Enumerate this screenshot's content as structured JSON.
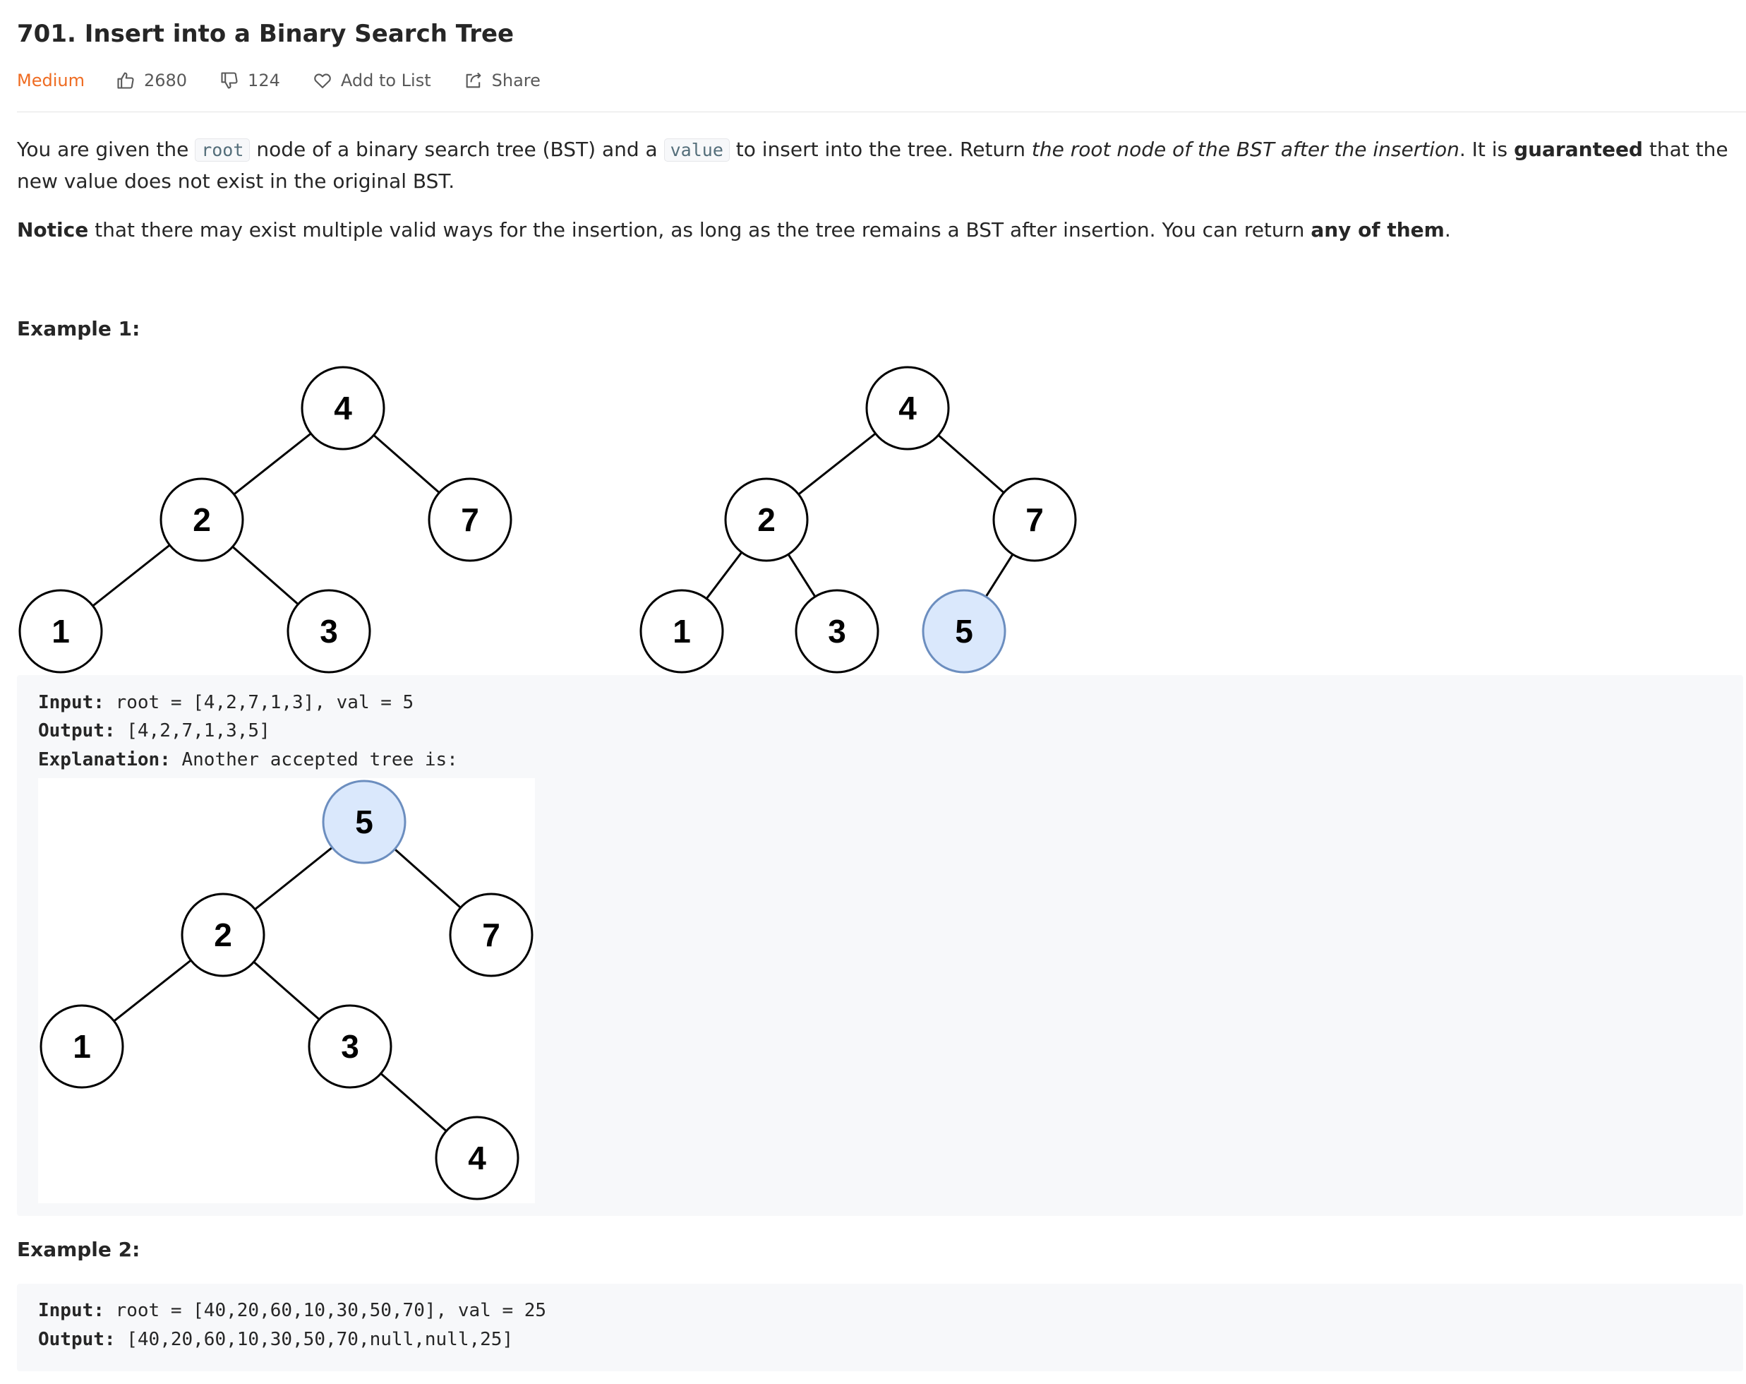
{
  "problem": {
    "title": "701. Insert into a Binary Search Tree",
    "difficulty": "Medium",
    "likes": "2680",
    "dislikes": "124",
    "add_to_list": "Add to List",
    "share": "Share"
  },
  "description": {
    "p1": {
      "t1": "You are given the ",
      "code1": "root",
      "t2": " node of a binary search tree (BST) and a ",
      "code2": "value",
      "t3": " to insert into the tree. Return ",
      "em": "the root node of the BST after the insertion",
      "t4": ". It is ",
      "strong": "guaranteed",
      "t5": " that the new value does not exist in the original BST."
    },
    "p2": {
      "strong1": "Notice",
      "t1": " that there may exist multiple valid ways for the insertion, as long as the tree remains a BST after insertion. You can return ",
      "strong2": "any of them",
      "t2": "."
    }
  },
  "example1": {
    "title": "Example 1:",
    "input_label": "Input:",
    "input_value": " root = [4,2,7,1,3], val = 5",
    "output_label": "Output:",
    "output_value": " [4,2,7,1,3,5]",
    "explanation_label": "Explanation:",
    "explanation_value": " Another accepted tree is:"
  },
  "example2": {
    "title": "Example 2:",
    "input_label": "Input:",
    "input_value": " root = [40,20,60,10,30,50,70], val = 25",
    "output_label": "Output:",
    "output_value": " [40,20,60,10,30,50,70,null,null,25]"
  },
  "trees": {
    "before": {
      "nodes": [
        "4",
        "2",
        "7",
        "1",
        "3"
      ],
      "highlight": []
    },
    "after": {
      "nodes": [
        "4",
        "2",
        "7",
        "1",
        "3",
        "5"
      ],
      "highlight": [
        "5"
      ]
    },
    "alt": {
      "nodes": [
        "5",
        "2",
        "7",
        "1",
        "3",
        "4"
      ],
      "highlight": [
        "5"
      ]
    }
  },
  "colors": {
    "difficulty": "#ef6c22",
    "highlight_fill": "#dae8fc",
    "highlight_stroke": "#6c8ebf"
  }
}
